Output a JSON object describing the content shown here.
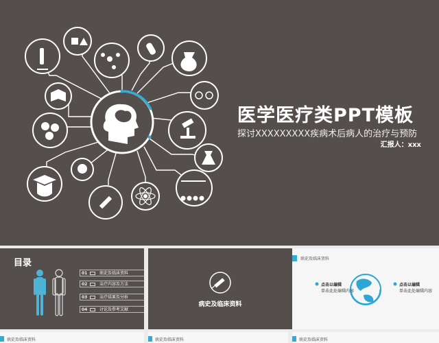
{
  "main_slide": {
    "title": "医学医疗类PPT模板",
    "subtitle": "探讨XXXXXXXXX疾病术后病人的治疗与预防",
    "reporter": "汇报人：xxx"
  },
  "thumbnails": {
    "toc": {
      "title": "目录",
      "items": [
        {
          "num": "01",
          "label": "病史及临床资料"
        },
        {
          "num": "02",
          "label": "治疗内容及方法"
        },
        {
          "num": "03",
          "label": "治疗结果及分析"
        },
        {
          "num": "04",
          "label": "讨论及参考文献"
        }
      ]
    },
    "section": {
      "label": "病史及临床资料"
    },
    "content": {
      "header": "病史及临床资料",
      "left_title": "点击以编辑",
      "left_text": "单击此处编辑内容",
      "right_title": "点击以编辑",
      "right_text": "单击此处编辑内容"
    }
  },
  "bottom_row": {
    "labels": [
      "病史及临床资料",
      "病史及临床资料",
      "病史及临床资料"
    ]
  },
  "colors": {
    "background": "#544e4d",
    "accent": "#38a9cf",
    "line": "#ffffff"
  }
}
